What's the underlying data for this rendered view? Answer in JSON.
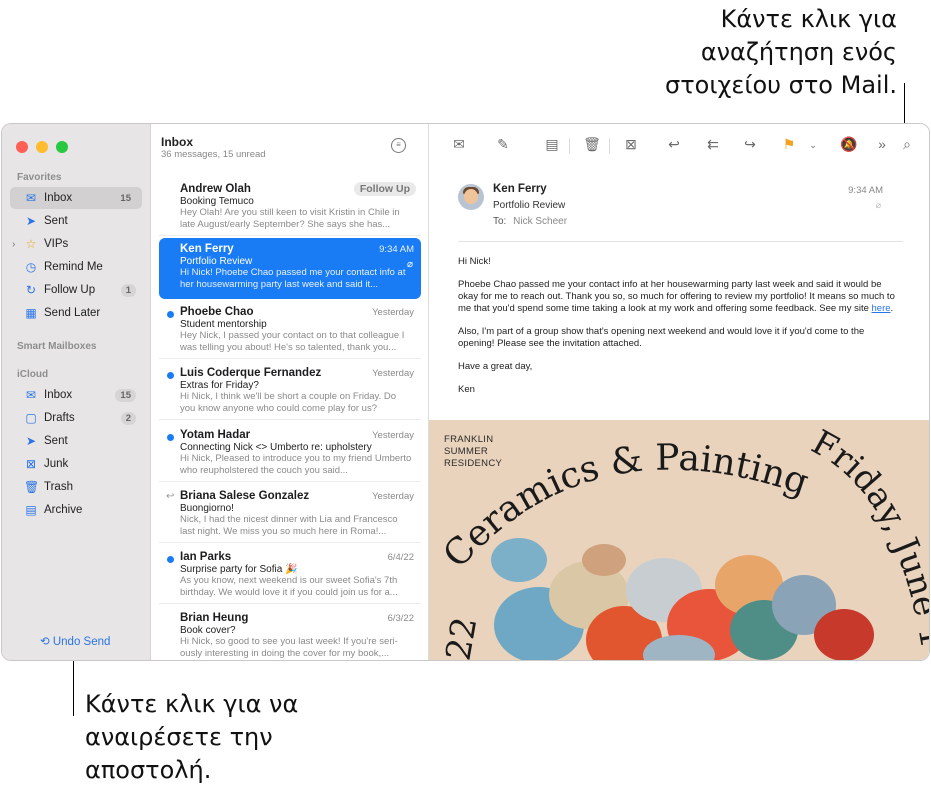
{
  "callouts": {
    "top": [
      "Κάντε κλικ για",
      "αναζήτηση ενός",
      "στοιχείου στο Mail."
    ],
    "bottom": [
      "Κάντε κλικ για να",
      "αναιρέσετε την",
      "αποστολή."
    ]
  },
  "sidebar": {
    "favorites_label": "Favorites",
    "favorites": [
      {
        "label": "Inbox",
        "icon": "inbox-icon",
        "badge": "15",
        "selected": true
      },
      {
        "label": "Sent",
        "icon": "paper-plane-icon"
      },
      {
        "label": "VIPs",
        "icon": "star-icon"
      },
      {
        "label": "Remind Me",
        "icon": "clock-icon"
      },
      {
        "label": "Follow Up",
        "icon": "follow-up-icon",
        "badge": "1"
      },
      {
        "label": "Send Later",
        "icon": "calendar-icon"
      }
    ],
    "smart_label": "Smart Mailboxes",
    "icloud_label": "iCloud",
    "icloud": [
      {
        "label": "Inbox",
        "icon": "inbox-icon",
        "badge": "15"
      },
      {
        "label": "Drafts",
        "icon": "document-icon",
        "badge": "2"
      },
      {
        "label": "Sent",
        "icon": "paper-plane-icon"
      },
      {
        "label": "Junk",
        "icon": "junk-icon"
      },
      {
        "label": "Trash",
        "icon": "trash-icon"
      },
      {
        "label": "Archive",
        "icon": "archive-icon"
      }
    ],
    "undo_send": "Undo Send"
  },
  "list": {
    "title": "Inbox",
    "subtitle": "36 messages, 15 unread",
    "messages": [
      {
        "from": "Andrew Olah",
        "subject": "Booking Temuco",
        "preview": "Hey Olah! Are you still keen to visit Kristin in Chile in late August/early September? She says she has...",
        "tag": "Follow Up"
      },
      {
        "from": "Ken Ferry",
        "date": "9:34 AM",
        "subject": "Portfolio Review",
        "preview": "Hi Nick! Phoebe Chao passed me your contact info at her housewarming party last week and said it...",
        "selected": true
      },
      {
        "from": "Phoebe Chao",
        "date": "Yesterday",
        "subject": "Student mentorship",
        "preview": "Hey Nick, I passed your contact on to that colleague I was telling you about! He's so talented, thank you...",
        "unread": true
      },
      {
        "from": "Luis Coderque Fernandez",
        "date": "Yesterday",
        "subject": "Extras for Friday?",
        "preview": "Hi Nick, I think we'll be short a couple on Friday. Do you know anyone who could come play for us?",
        "unread": true
      },
      {
        "from": "Yotam Hadar",
        "date": "Yesterday",
        "subject": "Connecting Nick <> Umberto re: upholstery",
        "preview": "Hi Nick, Pleased to introduce you to my friend Umberto who reupholstered the couch you said...",
        "unread": true
      },
      {
        "from": "Briana Salese Gonzalez",
        "date": "Yesterday",
        "subject": "Buongiorno!",
        "preview": "Nick, I had the nicest dinner with Lia and Francesco last night. We miss you so much here in Roma!...",
        "replied": true
      },
      {
        "from": "Ian Parks",
        "date": "6/4/22",
        "subject": "Surprise party for Sofia 🎉",
        "preview": "As you know, next weekend is our sweet Sofia's 7th birthday. We would love it if you could join us for a...",
        "unread": true
      },
      {
        "from": "Brian Heung",
        "date": "6/3/22",
        "subject": "Book cover?",
        "preview": "Hi Nick, so good to see you last week! If you're seri-ously interesting in doing the cover for my book,..."
      }
    ]
  },
  "reader": {
    "from": "Ken Ferry",
    "subject": "Portfolio Review",
    "to_label": "To:",
    "to": "Nick Scheer",
    "time": "9:34 AM",
    "body": {
      "greeting": "Hi Nick!",
      "p1": "Phoebe Chao passed me your contact info at her housewarming party last week and said it would be okay for me to reach out. Thank you so, so much for offering to review my portfolio! It means so much to me that you'd spend some time taking a look at my work and offering some feedback. See my site ",
      "p1_link": "here",
      "p1_end": ".",
      "p2": "Also, I'm part of a group show that's opening next weekend and would love it if you'd come to the opening! Please see the invitation attached.",
      "p3": "Have a great day,",
      "sign": "Ken"
    },
    "invite": {
      "residency": [
        "FRANKLIN",
        "SUMMER",
        "RESIDENCY"
      ],
      "arc_title": "Ceramics & Painting",
      "arc_date": "Friday, June 1",
      "left_num": "22"
    }
  },
  "colors": {
    "accent": "#1a7cf5",
    "flag": "#f5a122",
    "sidebar_bg": "#e7e5e5",
    "invite_bg": "#e9d3bd"
  }
}
